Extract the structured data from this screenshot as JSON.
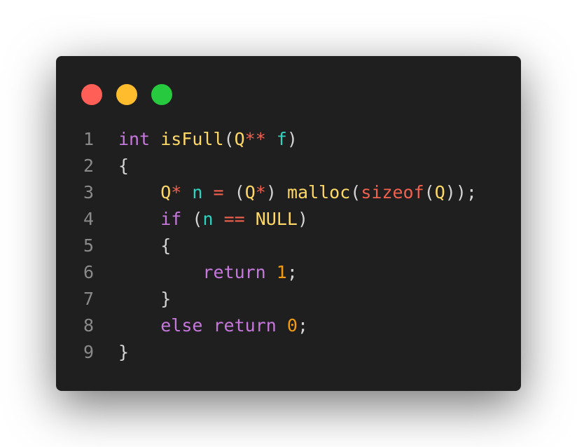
{
  "window": {
    "controls": {
      "close_color": "#ff5f56",
      "minimize_color": "#ffbd2e",
      "maximize_color": "#27c93f"
    }
  },
  "code": {
    "lines": [
      {
        "number": "1",
        "tokens": [
          {
            "text": "int",
            "kind": "keyword"
          },
          {
            "text": " ",
            "kind": "space"
          },
          {
            "text": "isFull",
            "kind": "function"
          },
          {
            "text": "(",
            "kind": "punct"
          },
          {
            "text": "Q",
            "kind": "type"
          },
          {
            "text": "**",
            "kind": "operator"
          },
          {
            "text": " ",
            "kind": "space"
          },
          {
            "text": "f",
            "kind": "variable"
          },
          {
            "text": ")",
            "kind": "punct"
          }
        ]
      },
      {
        "number": "2",
        "tokens": [
          {
            "text": "{",
            "kind": "punct"
          }
        ]
      },
      {
        "number": "3",
        "tokens": [
          {
            "text": "    ",
            "kind": "space"
          },
          {
            "text": "Q",
            "kind": "type"
          },
          {
            "text": "*",
            "kind": "operator"
          },
          {
            "text": " ",
            "kind": "space"
          },
          {
            "text": "n",
            "kind": "variable"
          },
          {
            "text": " ",
            "kind": "space"
          },
          {
            "text": "=",
            "kind": "operator"
          },
          {
            "text": " ",
            "kind": "space"
          },
          {
            "text": "(",
            "kind": "punct"
          },
          {
            "text": "Q",
            "kind": "type"
          },
          {
            "text": "*",
            "kind": "operator"
          },
          {
            "text": ")",
            "kind": "punct"
          },
          {
            "text": " ",
            "kind": "space"
          },
          {
            "text": "malloc",
            "kind": "function"
          },
          {
            "text": "(",
            "kind": "punct"
          },
          {
            "text": "sizeof",
            "kind": "operator"
          },
          {
            "text": "(",
            "kind": "punct"
          },
          {
            "text": "Q",
            "kind": "type"
          },
          {
            "text": "));",
            "kind": "punct"
          }
        ]
      },
      {
        "number": "4",
        "tokens": [
          {
            "text": "    ",
            "kind": "space"
          },
          {
            "text": "if",
            "kind": "keyword"
          },
          {
            "text": " ",
            "kind": "space"
          },
          {
            "text": "(",
            "kind": "punct"
          },
          {
            "text": "n",
            "kind": "variable"
          },
          {
            "text": " ",
            "kind": "space"
          },
          {
            "text": "==",
            "kind": "operator"
          },
          {
            "text": " ",
            "kind": "space"
          },
          {
            "text": "NULL",
            "kind": "type"
          },
          {
            "text": ")",
            "kind": "punct"
          }
        ]
      },
      {
        "number": "5",
        "tokens": [
          {
            "text": "    ",
            "kind": "space"
          },
          {
            "text": "{",
            "kind": "punct"
          }
        ]
      },
      {
        "number": "6",
        "tokens": [
          {
            "text": "        ",
            "kind": "space"
          },
          {
            "text": "return",
            "kind": "keyword"
          },
          {
            "text": " ",
            "kind": "space"
          },
          {
            "text": "1",
            "kind": "number"
          },
          {
            "text": ";",
            "kind": "punct"
          }
        ]
      },
      {
        "number": "7",
        "tokens": [
          {
            "text": "    ",
            "kind": "space"
          },
          {
            "text": "}",
            "kind": "punct"
          }
        ]
      },
      {
        "number": "8",
        "tokens": [
          {
            "text": "    ",
            "kind": "space"
          },
          {
            "text": "else",
            "kind": "keyword"
          },
          {
            "text": " ",
            "kind": "space"
          },
          {
            "text": "return",
            "kind": "keyword"
          },
          {
            "text": " ",
            "kind": "space"
          },
          {
            "text": "0",
            "kind": "number"
          },
          {
            "text": ";",
            "kind": "punct"
          }
        ]
      },
      {
        "number": "9",
        "tokens": [
          {
            "text": "}",
            "kind": "punct"
          }
        ]
      }
    ]
  }
}
